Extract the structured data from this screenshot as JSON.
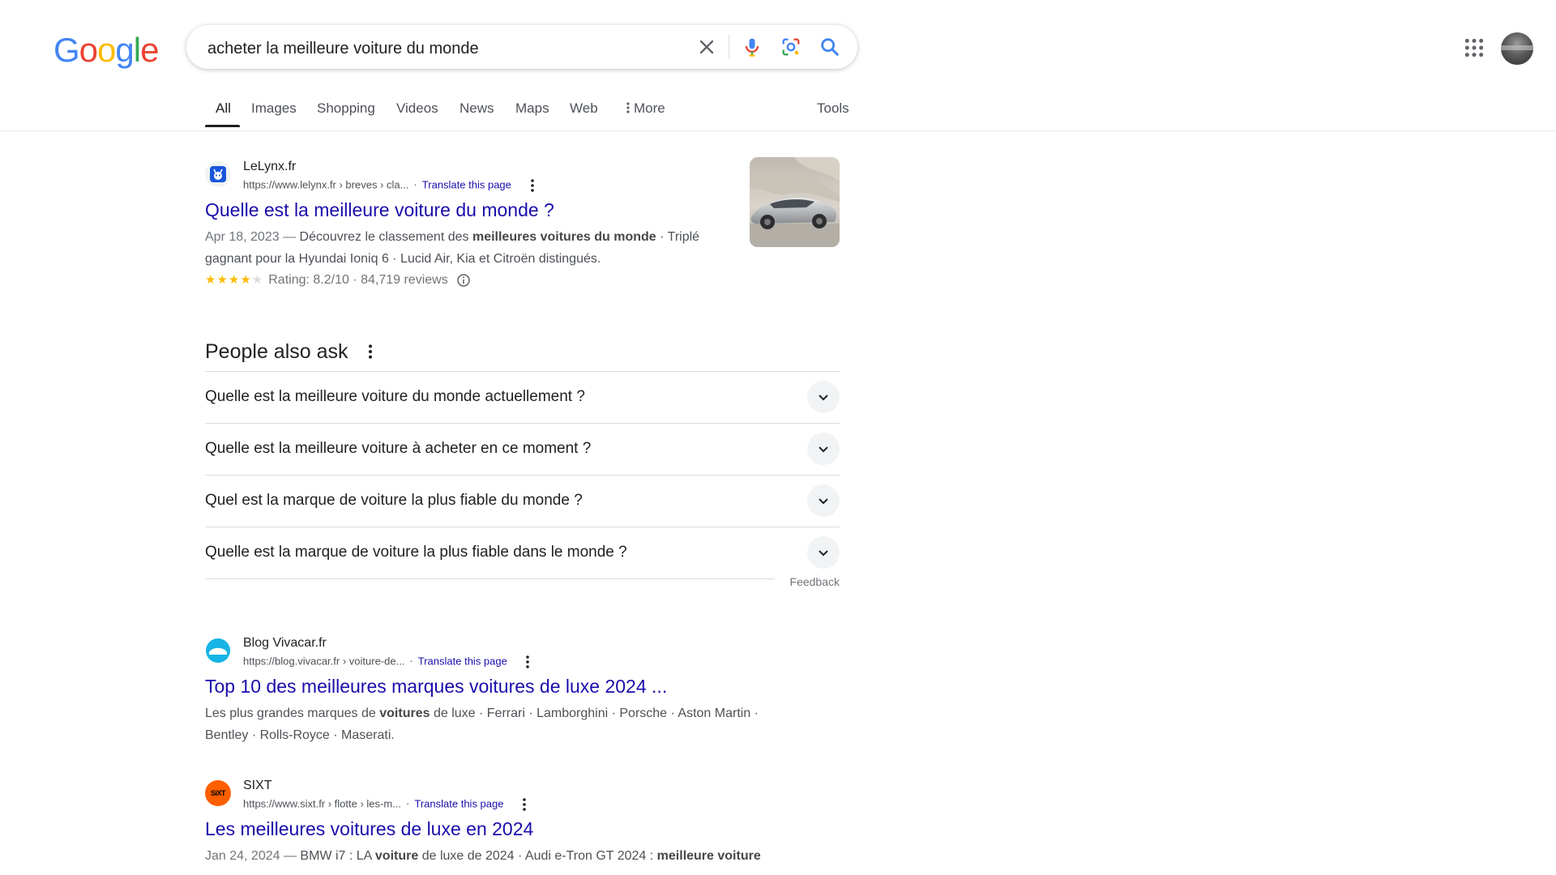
{
  "logo": {
    "letters": [
      "G",
      "o",
      "o",
      "g",
      "l",
      "e"
    ],
    "colors": [
      "#4285F4",
      "#EA4335",
      "#FBBC05",
      "#4285F4",
      "#34A853",
      "#EA4335"
    ]
  },
  "search": {
    "query": "acheter la meilleure voiture du monde"
  },
  "tabs": [
    {
      "label": "All",
      "active": true
    },
    {
      "label": "Images"
    },
    {
      "label": "Shopping"
    },
    {
      "label": "Videos"
    },
    {
      "label": "News"
    },
    {
      "label": "Maps"
    },
    {
      "label": "Web"
    },
    {
      "label": "More"
    }
  ],
  "tools_label": "Tools",
  "results": [
    {
      "site": "LeLynx.fr",
      "url": "https://www.lelynx.fr › breves › cla...",
      "translate": "Translate this page",
      "title": "Quelle est la meilleure voiture du monde ?",
      "snippet_date": "Apr 18, 2023 —",
      "snippet_1a": "Découvrez le classement des",
      "snippet_1b": "meilleures voitures du monde",
      "snippet_1c": "· Triplé gagnant pour la Hyundai Ioniq 6 · Lucid Air, Kia et Citroën distingués.",
      "stars": "★★★★",
      "star_empty": "★",
      "rating_value": 8.2,
      "rating_text": "Rating: 8.2/10 · 84,719 reviews"
    },
    {
      "site": "Blog Vivacar.fr",
      "url": "https://blog.vivacar.fr › voiture-de...",
      "translate": "Translate this page",
      "title": "Top 10 des meilleures marques voitures de luxe 2024 ...",
      "snippet_a": "Les plus grandes marques de",
      "snippet_b": "voitures",
      "snippet_c": "de luxe · Ferrari · Lamborghini · Porsche · Aston Martin · Bentley · Rolls-Royce · Maserati."
    },
    {
      "site": "SIXT",
      "url": "https://www.sixt.fr › flotte › les-m...",
      "translate": "Translate this page",
      "title": "Les meilleures voitures de luxe en 2024",
      "snippet_date": "Jan 24, 2024 —",
      "snippet_a": "BMW i7 : LA",
      "snippet_b": "voiture",
      "snippet_c": "de luxe de 2024 · Audi e-Tron GT 2024 :",
      "snippet_d": "meilleure voiture",
      "favicon_text": "SiXT"
    }
  ],
  "paa": {
    "heading": "People also ask",
    "questions": [
      "Quelle est la meilleure voiture du monde actuellement ?",
      "Quelle est la meilleure voiture à acheter en ce moment ?",
      "Quel est la marque de voiture la plus fiable du monde ?",
      "Quelle est la marque de voiture la plus fiable dans le monde ?"
    ],
    "feedback": "Feedback"
  },
  "colors": {
    "link": "#1a0dab",
    "star": "#fbbc04",
    "vivacar": "#16b5e6",
    "sixt": "#ff5f00",
    "lelynx": "#1a56db"
  }
}
